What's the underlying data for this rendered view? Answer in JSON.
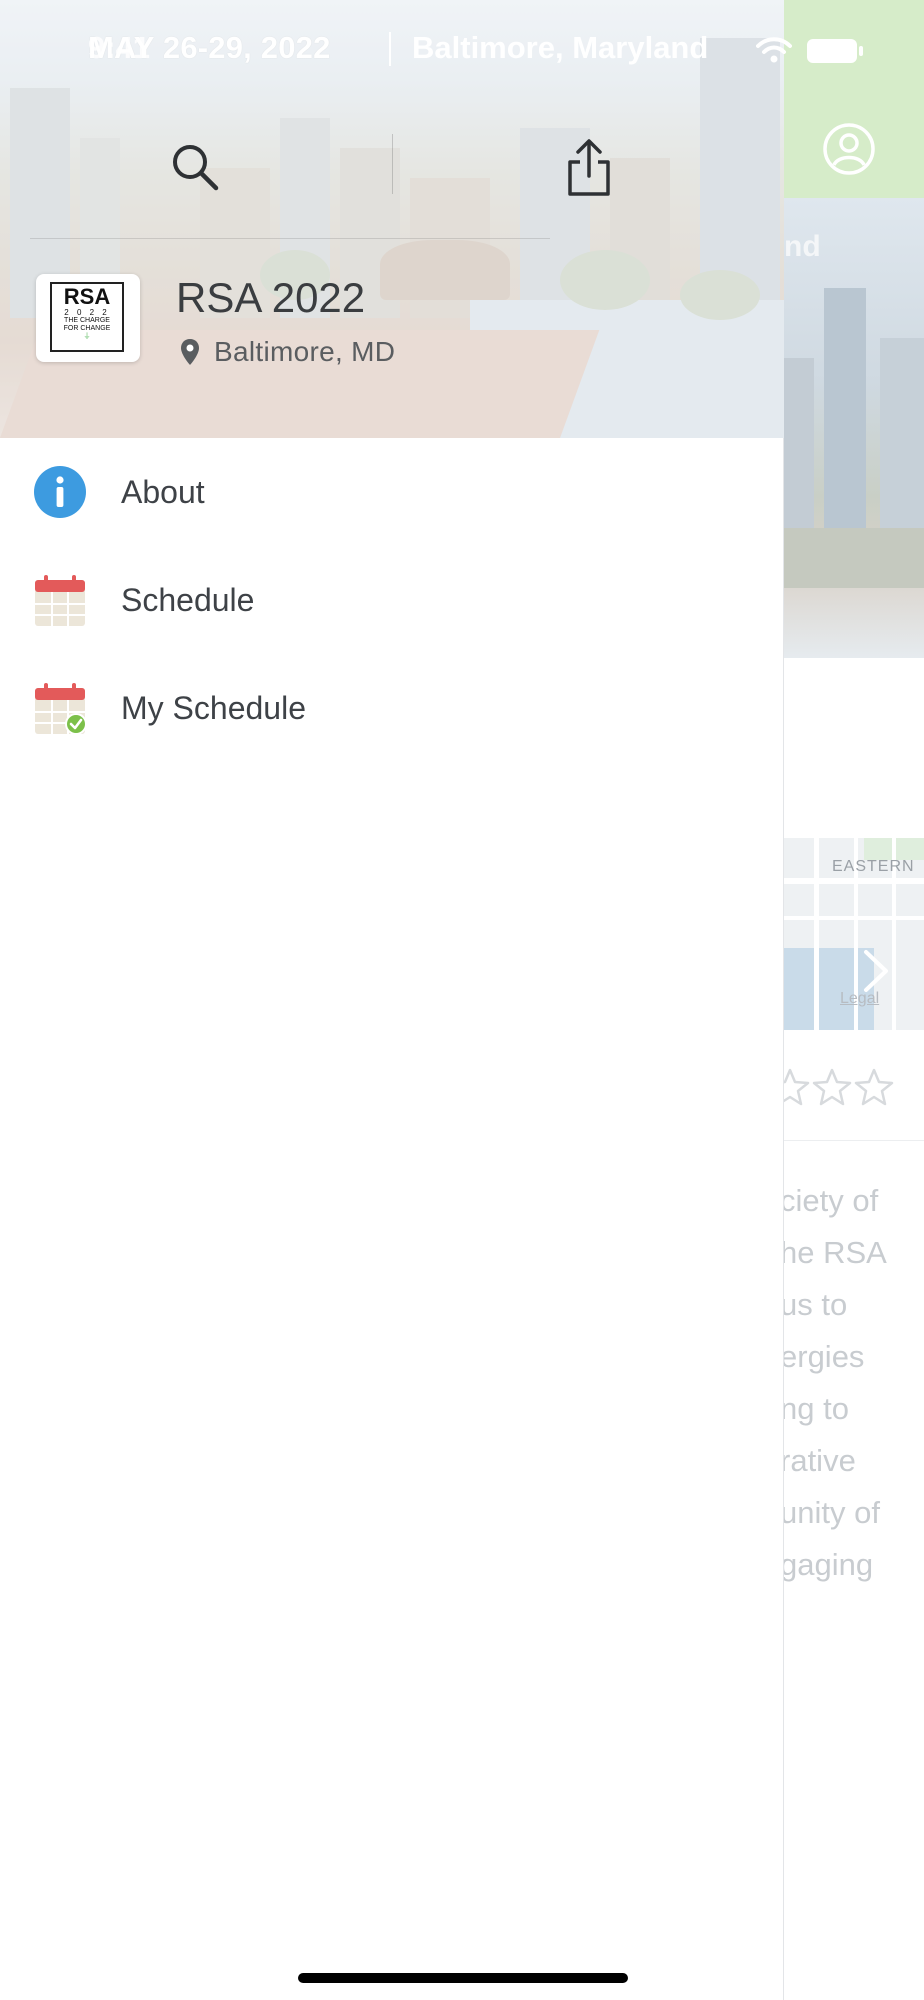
{
  "status_bar": {
    "time": "9:41",
    "banner_dates": "MAY 26-29, 2022",
    "banner_location": "Baltimore, Maryland"
  },
  "drawer": {
    "event_title": "RSA 2022",
    "event_location": "Baltimore, MD",
    "logo": {
      "name": "RSA",
      "year": "2 0 2 2",
      "tagline_1": "THE CHARGE",
      "tagline_2": "FOR CHANGE"
    },
    "menu": [
      {
        "label": "About",
        "icon": "info-icon"
      },
      {
        "label": "Schedule",
        "icon": "calendar-icon"
      },
      {
        "label": "My Schedule",
        "icon": "calendar-check-icon"
      }
    ]
  },
  "background": {
    "hero_partial_title": "nd",
    "map_label": "EASTERN",
    "map_legal": "Legal",
    "rating_stars": 0,
    "description_fragments": [
      "ciety of",
      "he RSA",
      "us to",
      "ergies",
      "ng to",
      "rative",
      "unity of",
      "gaging"
    ]
  },
  "colors": {
    "accent_header": "#d6ecc9",
    "info_blue": "#3d9be0",
    "calendar_red": "#e35a5a",
    "check_green": "#7cc04a"
  }
}
